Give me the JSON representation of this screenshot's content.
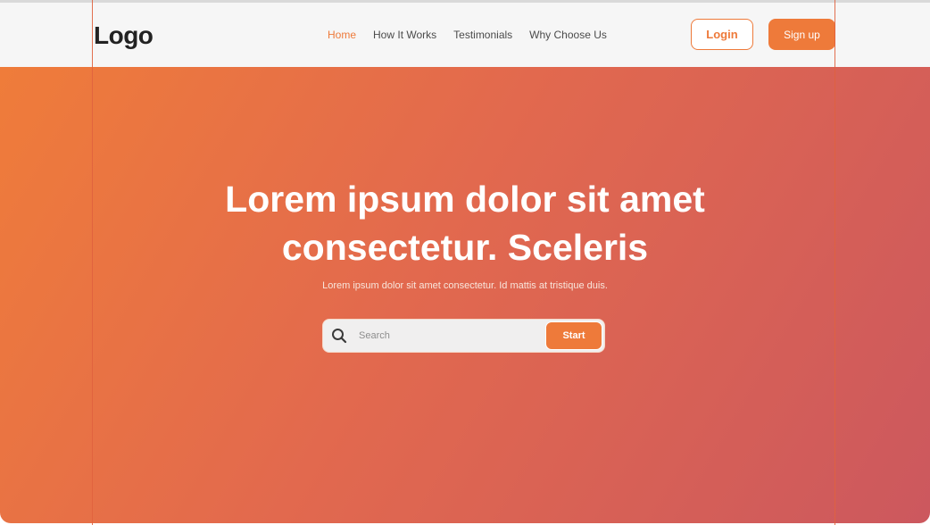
{
  "header": {
    "logo": "Logo",
    "nav": [
      {
        "label": "Home",
        "active": true
      },
      {
        "label": "How It Works",
        "active": false
      },
      {
        "label": "Testimonials",
        "active": false
      },
      {
        "label": "Why Choose Us",
        "active": false
      }
    ],
    "login_label": "Login",
    "signup_label": "Sign up"
  },
  "hero": {
    "title_line1": "Lorem ipsum dolor sit amet",
    "title_line2": "consectetur. Sceleris",
    "subtitle": "Lorem ipsum dolor sit amet consectetur. Id mattis at tristique duis.",
    "search": {
      "placeholder": "Search",
      "value": "",
      "button_label": "Start"
    }
  },
  "colors": {
    "accent": "#ee7a3a",
    "gradient_start": "#ef7c3a",
    "gradient_end": "#cc585e",
    "header_bg": "#f6f6f6"
  },
  "icons": {
    "search": "search-icon"
  }
}
